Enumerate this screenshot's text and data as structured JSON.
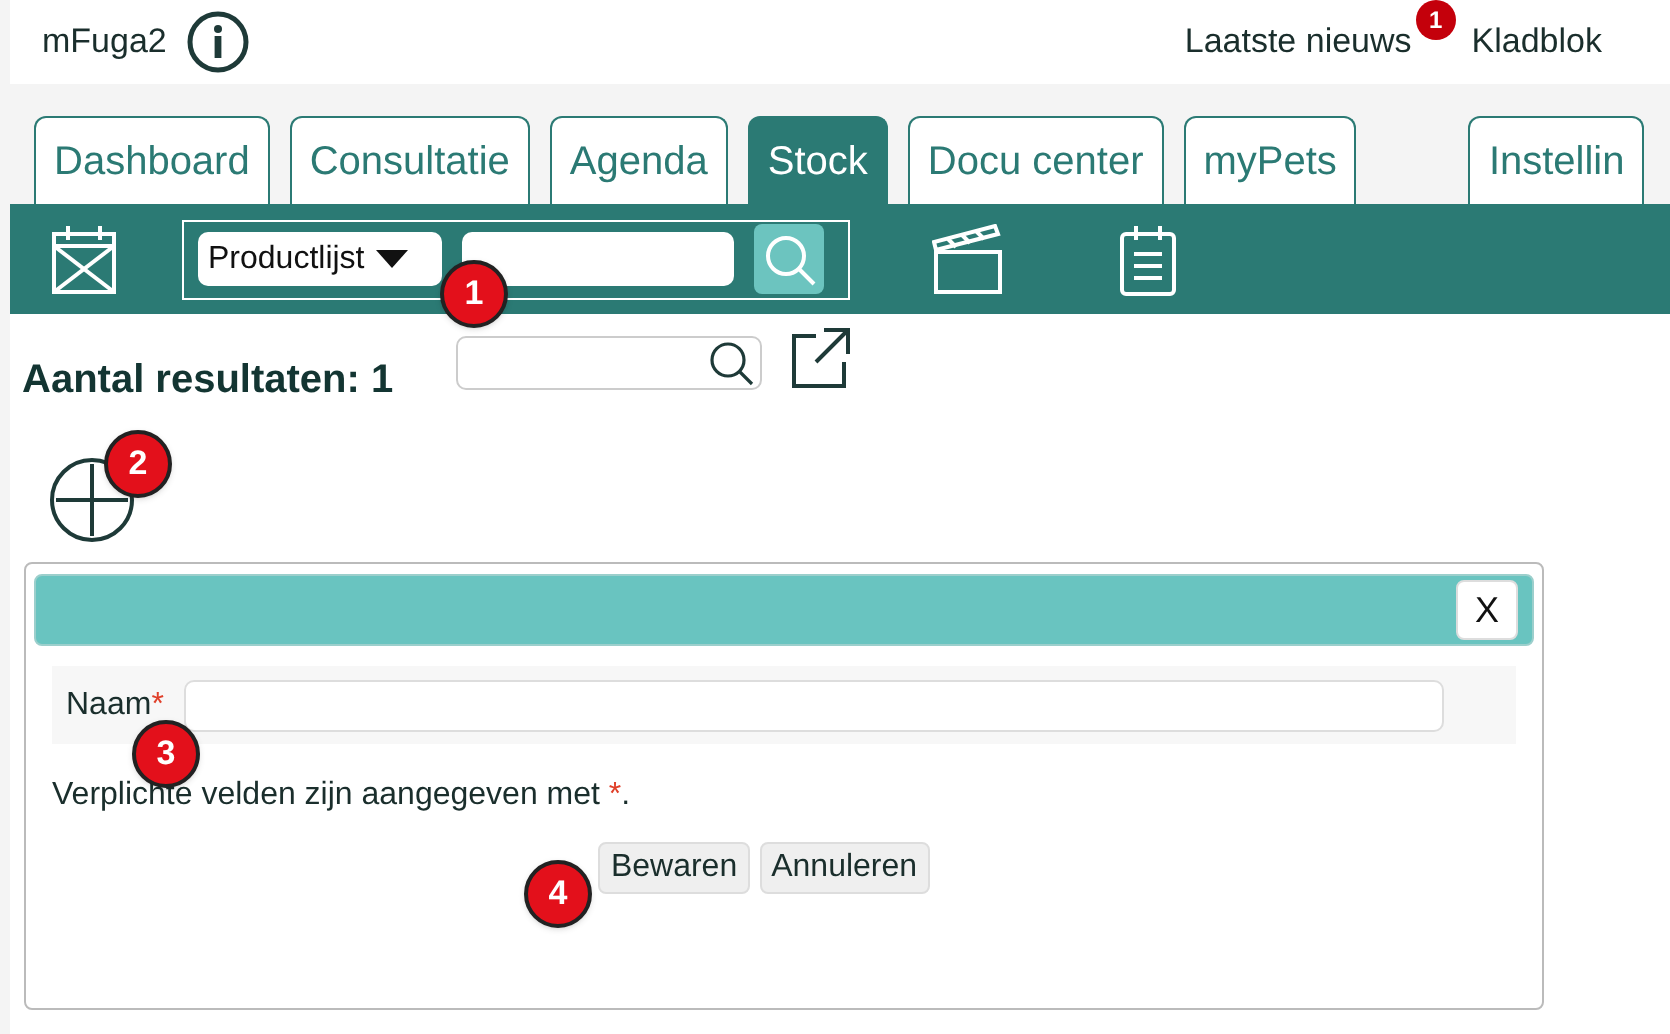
{
  "header": {
    "app_name": "mFuga2",
    "links": [
      {
        "label": "Laatste nieuws",
        "badge": "1"
      },
      {
        "label": "Kladblok"
      }
    ]
  },
  "tabs": [
    {
      "label": "Dashboard",
      "selected": false
    },
    {
      "label": "Consultatie",
      "selected": false
    },
    {
      "label": "Agenda",
      "selected": false
    },
    {
      "label": "Stock",
      "selected": true
    },
    {
      "label": "Docu center",
      "selected": false
    },
    {
      "label": "myPets",
      "selected": false
    },
    {
      "label": "Instellin",
      "selected": false
    }
  ],
  "toolbar": {
    "select": {
      "value": "Productlijst"
    }
  },
  "results": {
    "heading": "Aantal resultaten: 1"
  },
  "dialog": {
    "close": "X",
    "fields": [
      {
        "label": "Naam",
        "required_mark": "*"
      }
    ],
    "note": {
      "before": "Verplichte velden zijn aangegeven met ",
      "mark": "*",
      "after": "."
    },
    "buttons": [
      "Bewaren",
      "Annuleren"
    ]
  },
  "callouts": [
    {
      "number": "1"
    },
    {
      "number": "2"
    },
    {
      "number": "3"
    },
    {
      "number": "4"
    }
  ]
}
